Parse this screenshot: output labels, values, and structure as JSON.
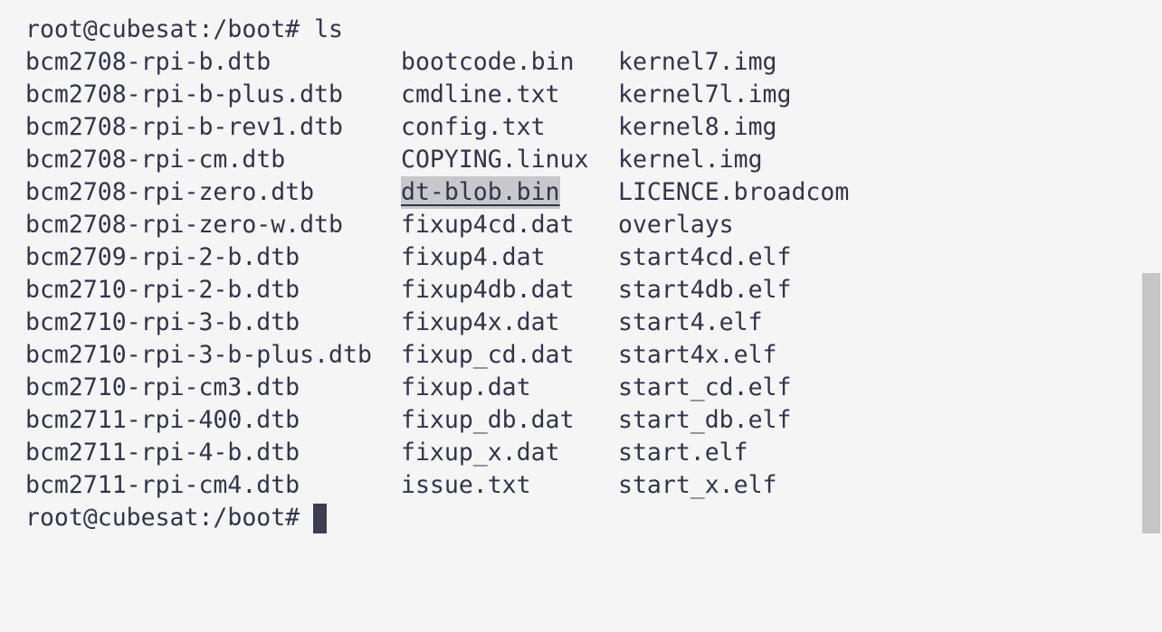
{
  "terminal": {
    "command_line": "root@cubesat:/boot# ls",
    "prompt": "root@cubesat:/boot#",
    "rows": [
      [
        "bcm2708-rpi-b.dtb",
        "bootcode.bin",
        "kernel7.img"
      ],
      [
        "bcm2708-rpi-b-plus.dtb",
        "cmdline.txt",
        "kernel7l.img"
      ],
      [
        "bcm2708-rpi-b-rev1.dtb",
        "config.txt",
        "kernel8.img"
      ],
      [
        "bcm2708-rpi-cm.dtb",
        "COPYING.linux",
        "kernel.img"
      ],
      [
        "bcm2708-rpi-zero.dtb",
        "dt-blob.bin",
        "LICENCE.broadcom"
      ],
      [
        "bcm2708-rpi-zero-w.dtb",
        "fixup4cd.dat",
        "overlays"
      ],
      [
        "bcm2709-rpi-2-b.dtb",
        "fixup4.dat",
        "start4cd.elf"
      ],
      [
        "bcm2710-rpi-2-b.dtb",
        "fixup4db.dat",
        "start4db.elf"
      ],
      [
        "bcm2710-rpi-3-b.dtb",
        "fixup4x.dat",
        "start4.elf"
      ],
      [
        "bcm2710-rpi-3-b-plus.dtb",
        "fixup_cd.dat",
        "start4x.elf"
      ],
      [
        "bcm2710-rpi-cm3.dtb",
        "fixup.dat",
        "start_cd.elf"
      ],
      [
        "bcm2711-rpi-400.dtb",
        "fixup_db.dat",
        "start_db.elf"
      ],
      [
        "bcm2711-rpi-4-b.dtb",
        "fixup_x.dat",
        "start.elf"
      ],
      [
        "bcm2711-rpi-cm4.dtb",
        "issue.txt",
        "start_x.elf"
      ]
    ],
    "selected_entry": "dt-blob.bin"
  },
  "colors": {
    "background": "#f5f5f5",
    "text": "#33334a",
    "cursor": "#3e3c52",
    "selection": "#c8c8cc",
    "scrollbar": "#c6c6c6"
  }
}
